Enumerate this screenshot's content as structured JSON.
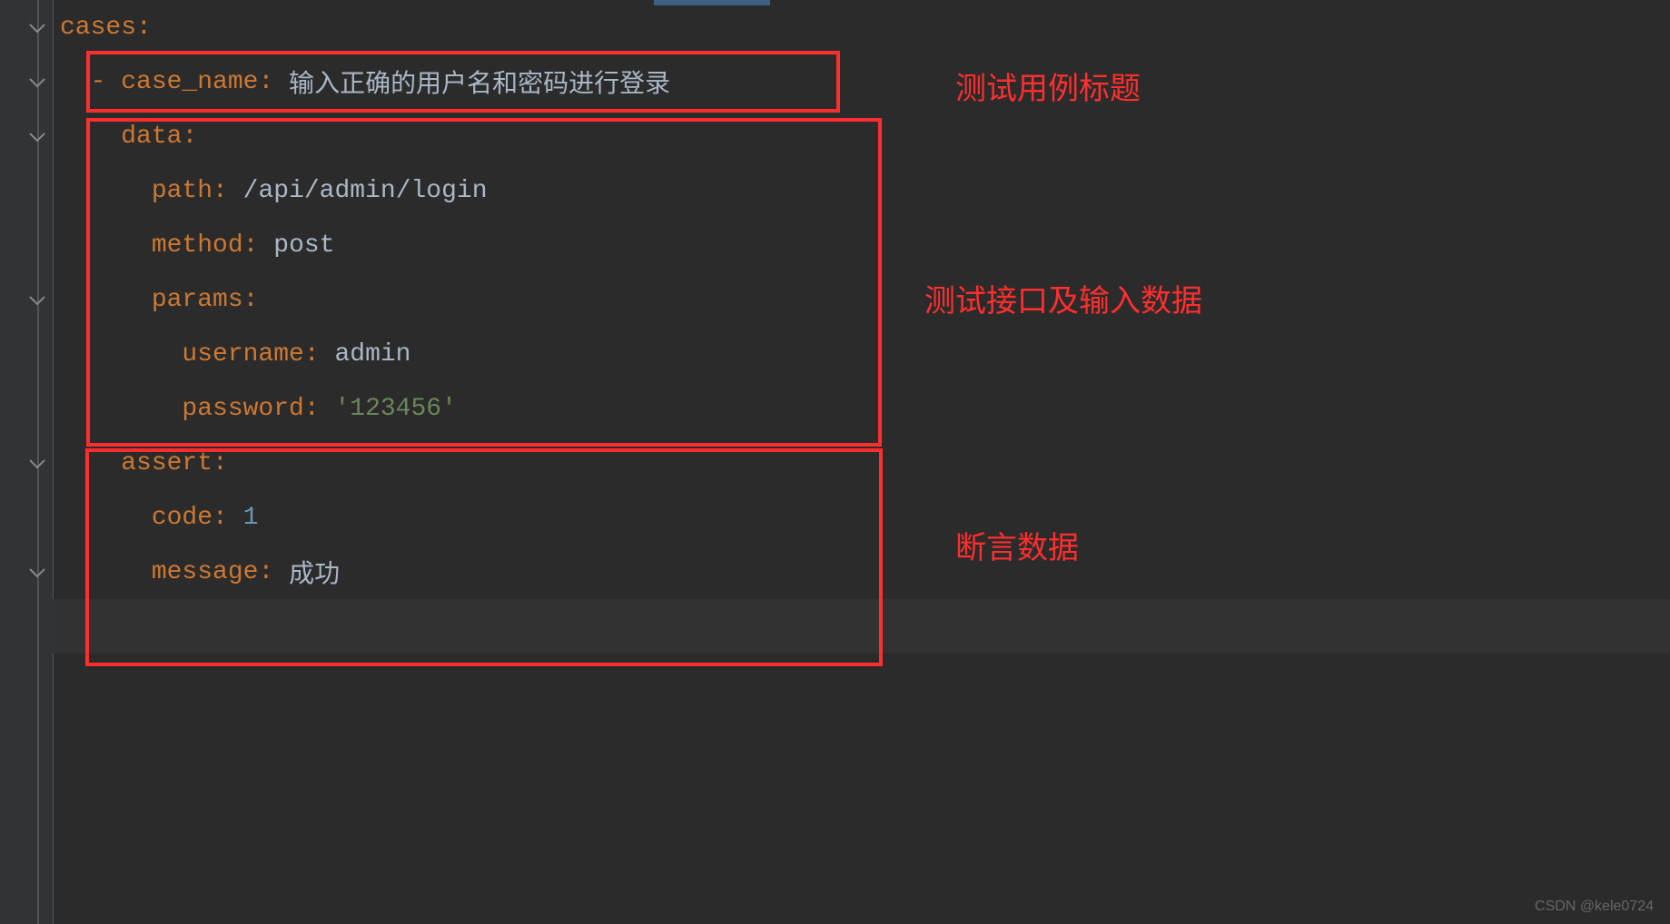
{
  "yaml": {
    "cases_key": "cases",
    "dash": "- ",
    "case_name_key": "case_name",
    "case_name_value": "输入正确的用户名和密码进行登录",
    "data_key": "data",
    "path_key": "path",
    "path_value": "/api/admin/login",
    "method_key": "method",
    "method_value": "post",
    "params_key": "params",
    "username_key": "username",
    "username_value": "admin",
    "password_key": "password",
    "password_value": "'123456'",
    "assert_key": "assert",
    "code_key": "code",
    "code_value": "1",
    "message_key": "message",
    "message_value": "成功"
  },
  "annotations": {
    "title_label": "测试用例标题",
    "data_label": "测试接口及输入数据",
    "assert_label": "断言数据"
  },
  "watermark": "CSDN @kele0724"
}
